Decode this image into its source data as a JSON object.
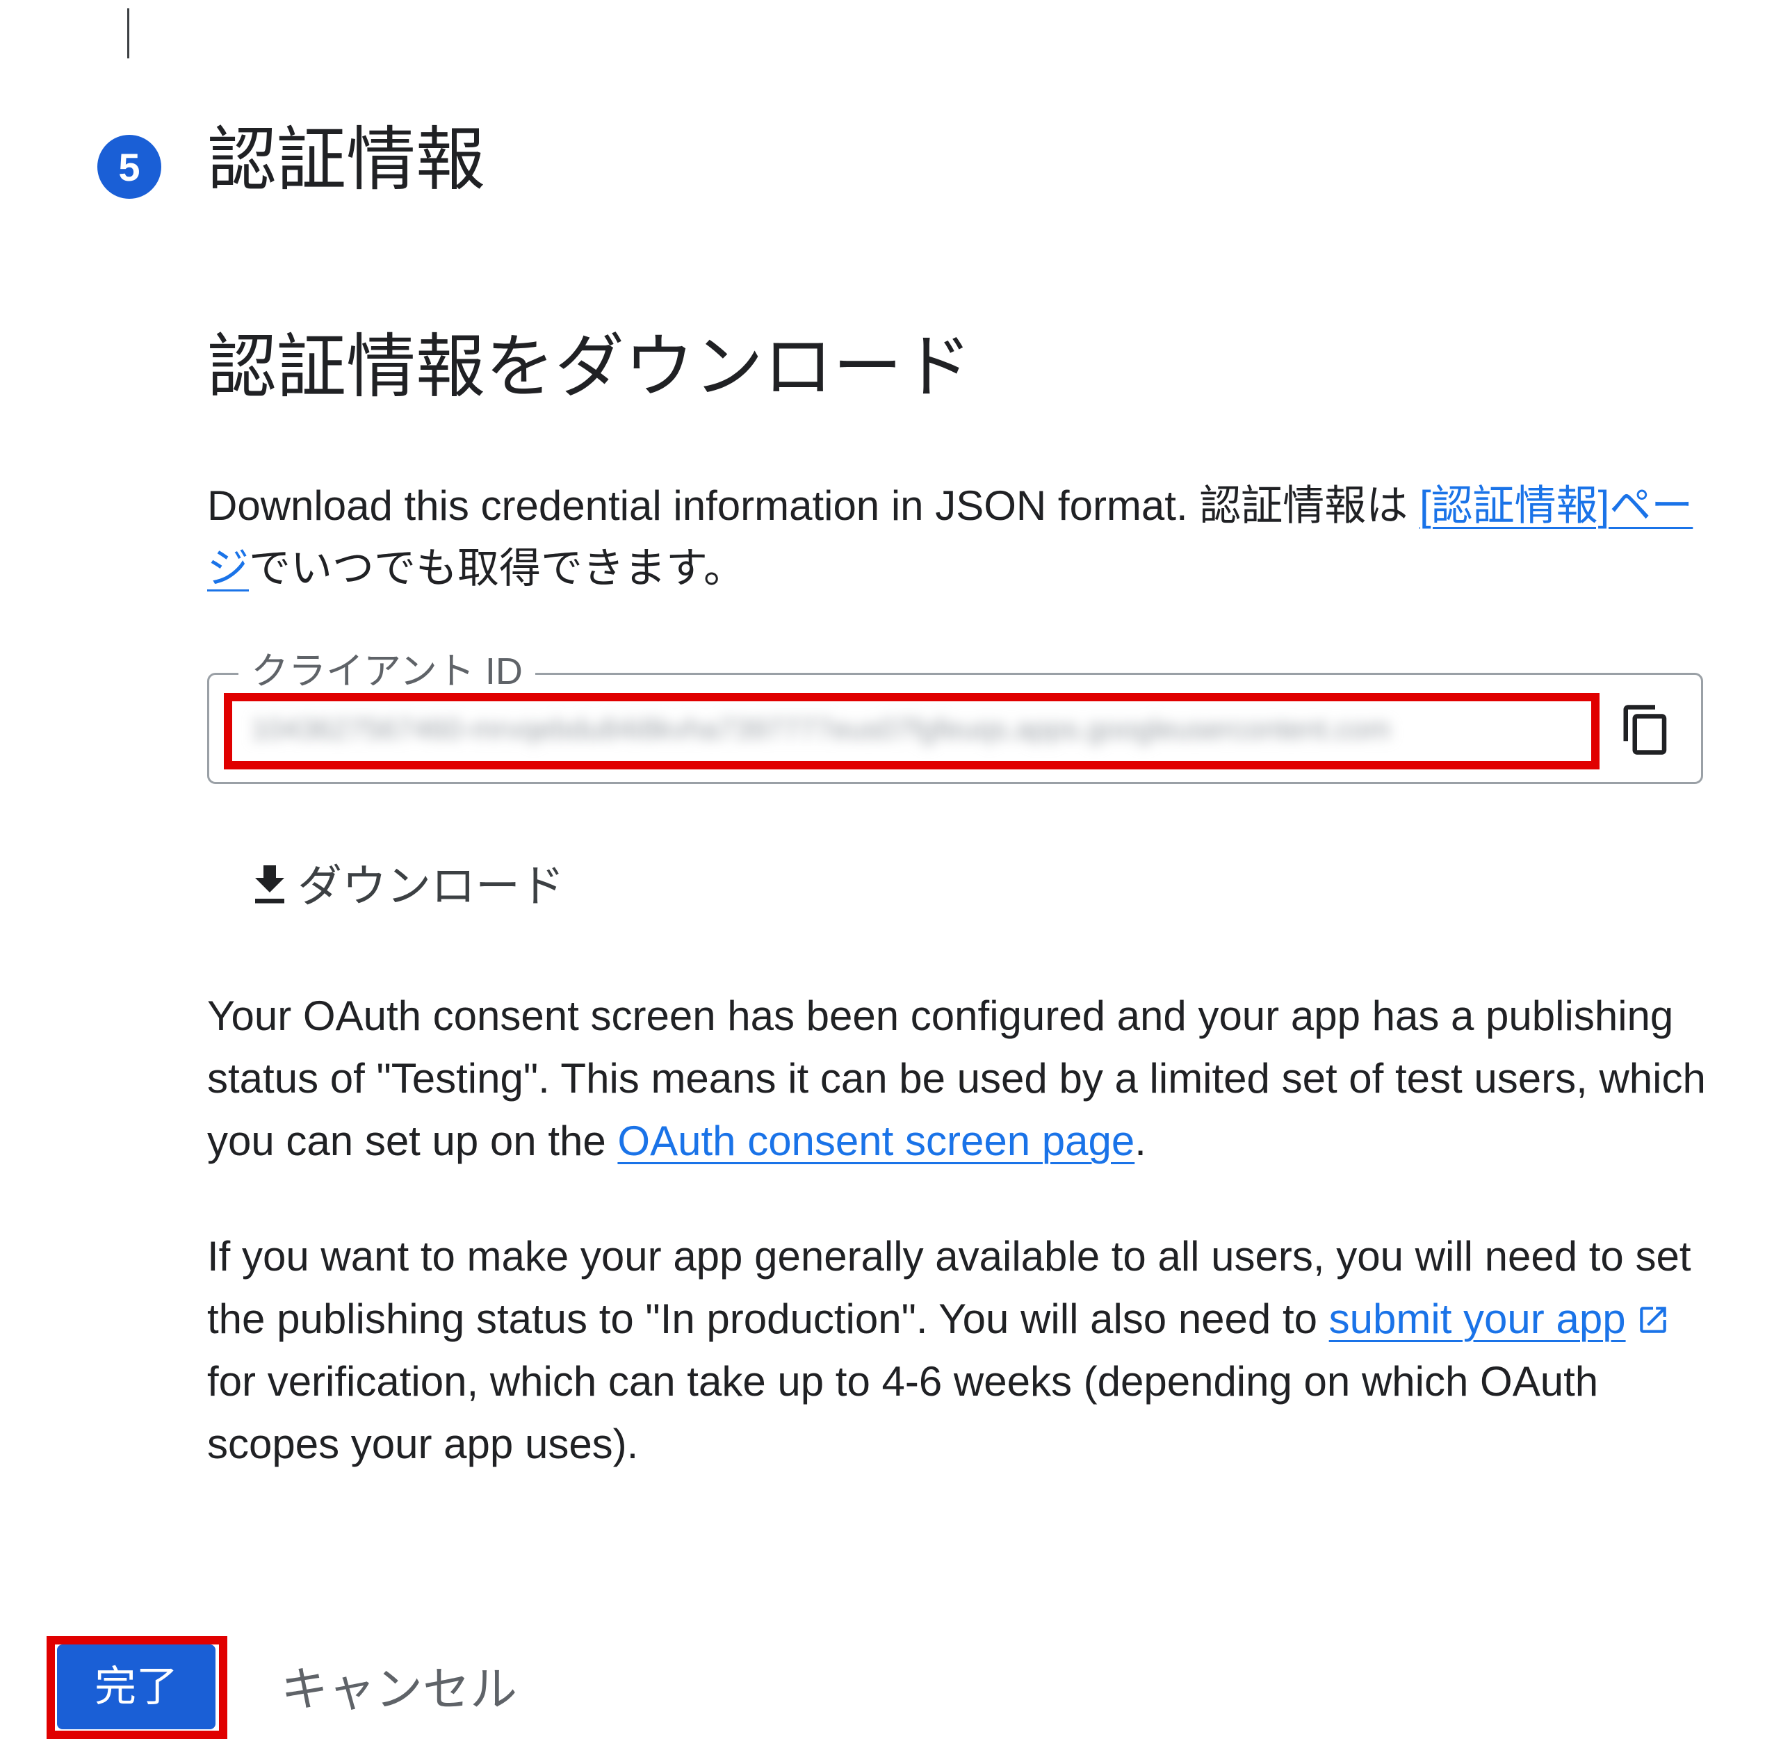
{
  "step": {
    "number": "5",
    "title": "認証情報"
  },
  "download_section": {
    "title": "認証情報をダウンロード",
    "description_prefix": "Download this credential information in JSON format. 認証情報は ",
    "description_link": "[認証情報]ページ",
    "description_suffix": "でいつでも取得できます。"
  },
  "client_id_field": {
    "label": "クライアント ID",
    "value": "1043627567460-mrvqebdu84i8kvha7397777eus07fgfeuqs.apps.googleusercontent.com"
  },
  "download_button": {
    "label": "ダウンロード"
  },
  "consent_paragraph": {
    "prefix": "Your OAuth consent screen has been configured and your app has a publishing status of \"Testing\". This means it can be used by a limited set of test users, which you can set up on the ",
    "link": "OAuth consent screen page",
    "suffix": "."
  },
  "production_paragraph": {
    "prefix": "If you want to make your app generally available to all users, you will need to set the publishing status to \"In production\". You will also need to ",
    "link": "submit your app",
    "suffix": "for verification, which can take up to 4-6 weeks (depending on which OAuth scopes your app uses)."
  },
  "actions": {
    "done_label": "完了",
    "cancel_label": "キャンセル"
  },
  "colors": {
    "accent": "#1a5fd6",
    "link": "#1a73e8",
    "highlight": "#e00000"
  },
  "icons": [
    "copy-icon",
    "download-icon",
    "external-link-icon"
  ]
}
